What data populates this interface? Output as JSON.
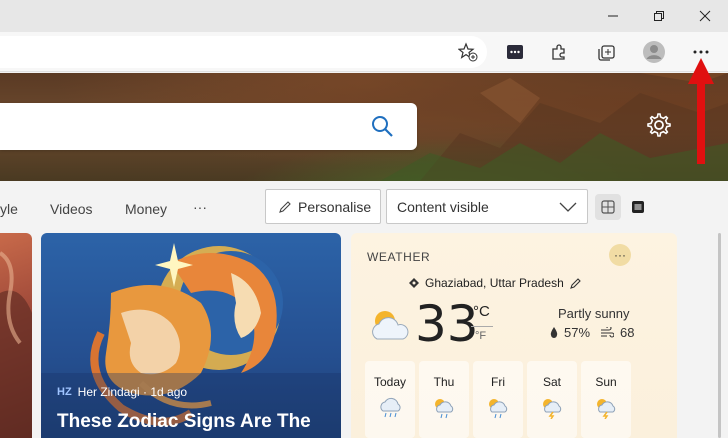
{
  "window": {
    "controls": [
      "minimize",
      "restore",
      "close"
    ]
  },
  "toolbar": {
    "icons": [
      "favorite-add-icon",
      "extension-media-icon",
      "extensions-icon",
      "collections-icon",
      "profile-icon",
      "more-icon"
    ]
  },
  "nav": {
    "partial_item": "yle",
    "items": [
      "Videos",
      "Money"
    ],
    "more": "···",
    "personalise_label": "Personalise",
    "content_select": "Content visible"
  },
  "news_card": {
    "source_logo": "HZ",
    "source": "Her Zindagi · 1d ago",
    "headline": "These Zodiac Signs Are The"
  },
  "weather": {
    "title": "WEATHER",
    "more": "···",
    "location": "Ghaziabad, Uttar Pradesh",
    "temperature": "33",
    "unit_c": "°C",
    "unit_f": "°F",
    "condition": "Partly sunny",
    "humidity": "57%",
    "wind": "68",
    "forecast": [
      {
        "day": "Today",
        "icon": "rain-cloud-icon"
      },
      {
        "day": "Thu",
        "icon": "sun-rain-icon"
      },
      {
        "day": "Fri",
        "icon": "sun-rain-icon"
      },
      {
        "day": "Sat",
        "icon": "thunder-cloud-icon"
      },
      {
        "day": "Sun",
        "icon": "thunder-cloud-icon"
      }
    ]
  },
  "colors": {
    "arrow": "#e01010",
    "accent_blue": "#1f6fbf"
  }
}
